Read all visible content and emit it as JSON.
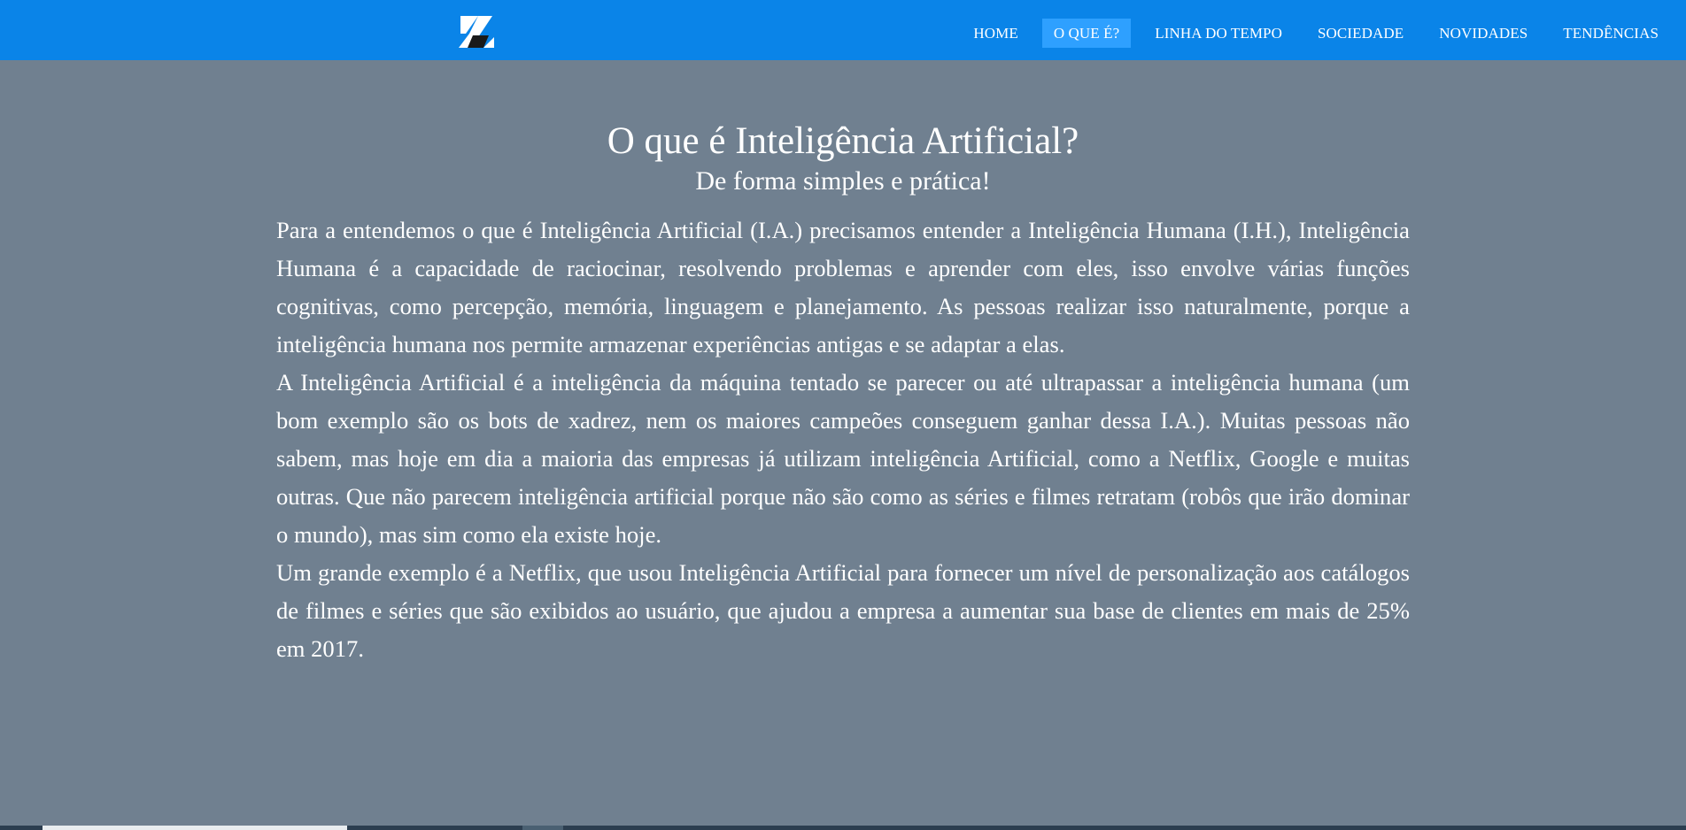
{
  "nav": {
    "logo_icon": "zz-logo-icon",
    "links": [
      {
        "label": "HOME"
      },
      {
        "label": "O QUE É?"
      },
      {
        "label": "LINHA DO TEMPO"
      },
      {
        "label": "SOCIEDADE"
      },
      {
        "label": "NOVIDADES"
      },
      {
        "label": "TENDÊNCIAS"
      }
    ],
    "active_index": 1
  },
  "main": {
    "title": "O que é Inteligência Artificial?",
    "subtitle": "De forma simples e prática!",
    "paragraphs": [
      "Para a entendemos o que é Inteligência Artificial (I.A.) precisamos entender a Inteligência Humana (I.H.), Inteligência Humana é a capacidade de raciocinar, resolvendo problemas e aprender com eles, isso envolve várias funções cognitivas, como percepção, memória, linguagem e planejamento. As pessoas realizar isso naturalmente, porque a inteligência humana nos permite armazenar experiências antigas e se adaptar a elas.",
      "A Inteligência Artificial é a inteligência da máquina tentado se parecer ou até ultrapassar a inteligência humana (um bom exemplo são os bots de xadrez, nem os maiores campeões conseguem ganhar dessa I.A.). Muitas pessoas não sabem, mas hoje em dia a maioria das empresas já utilizam inteligência Artificial, como a Netflix, Google e muitas outras. Que não parecem inteligência artificial porque não são como as séries e filmes retratam (robôs que irão dominar o mundo), mas sim como ela existe hoje.",
      "Um grande exemplo é a Netflix, que usou Inteligência Artificial para fornecer um nível de personalização aos catálogos de filmes e séries que são exibidos ao usuário, que ajudou a empresa a aumentar sua base de clientes em mais de 25% em 2017."
    ]
  },
  "colors": {
    "navbar": "#0a84e8",
    "nav_active": "#2ea0ff",
    "background": "#708090",
    "text": "#ffffff"
  }
}
